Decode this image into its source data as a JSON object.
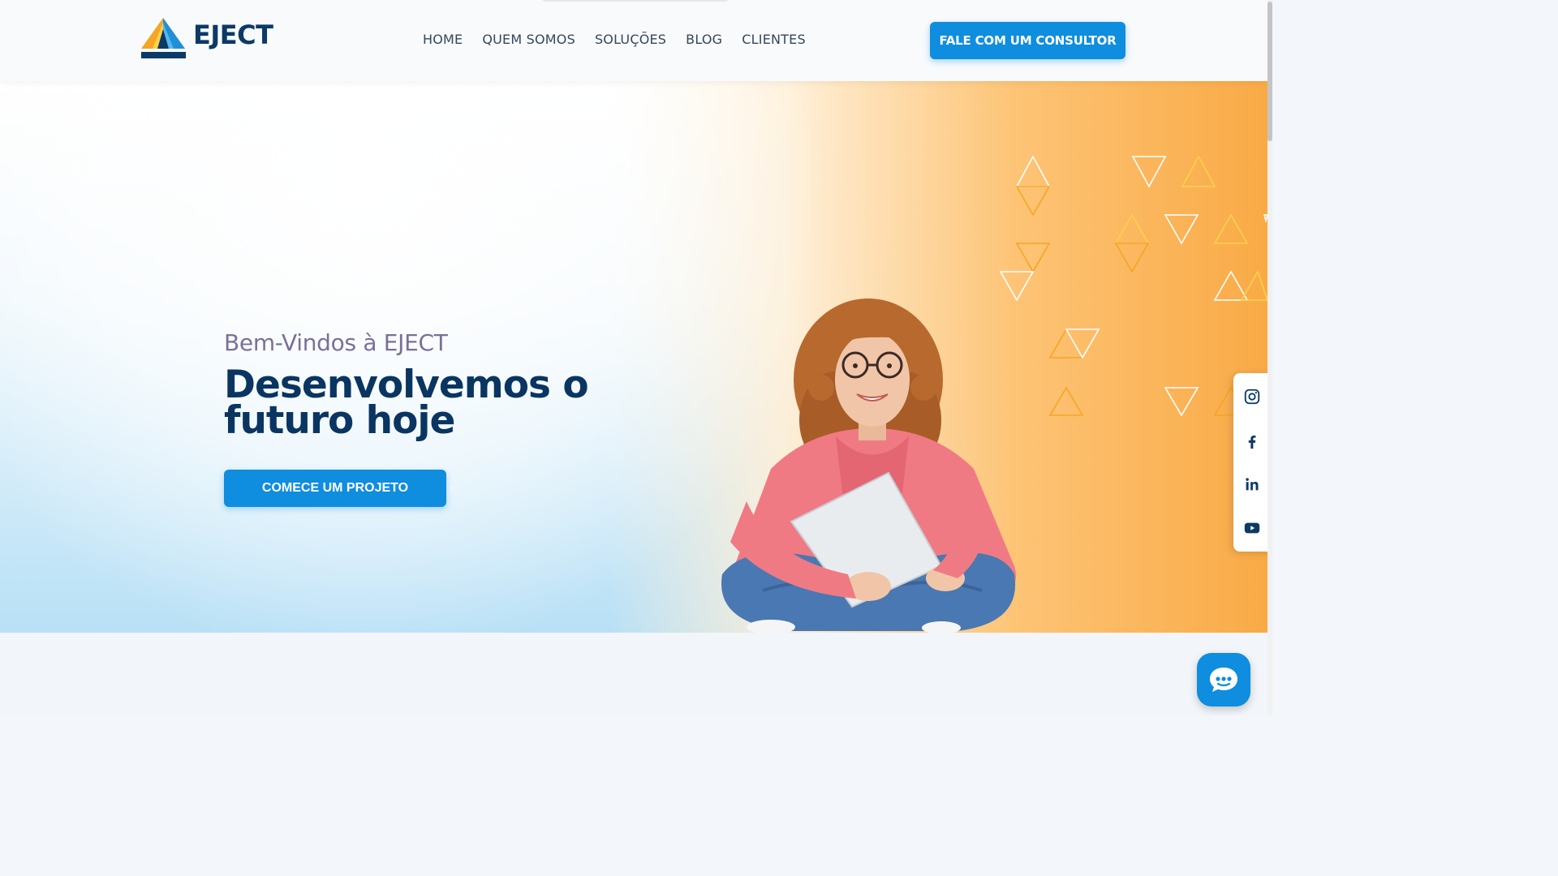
{
  "brand": {
    "name": "EJECT"
  },
  "nav": {
    "items": [
      {
        "label": "HOME"
      },
      {
        "label": "QUEM SOMOS"
      },
      {
        "label": "SOLUÇÕES"
      },
      {
        "label": "BLOG"
      },
      {
        "label": "CLIENTES"
      }
    ],
    "cta_label": "FALE COM UM CONSULTOR"
  },
  "hero": {
    "greeting": "Bem-Vindos à EJECT",
    "title": "Desenvolvemos o futuro hoje",
    "cta_label": "COMECE UM PROJETO"
  },
  "social": {
    "items": [
      {
        "icon": "instagram-icon"
      },
      {
        "icon": "facebook-icon"
      },
      {
        "icon": "linkedin-icon"
      },
      {
        "icon": "youtube-icon"
      }
    ]
  },
  "chat": {
    "icon": "chat-bubble-icon"
  },
  "colors": {
    "primary": "#0f8ddf",
    "navy": "#0a3561",
    "orange": "#f9aa46",
    "greeting": "#7b6f99"
  }
}
